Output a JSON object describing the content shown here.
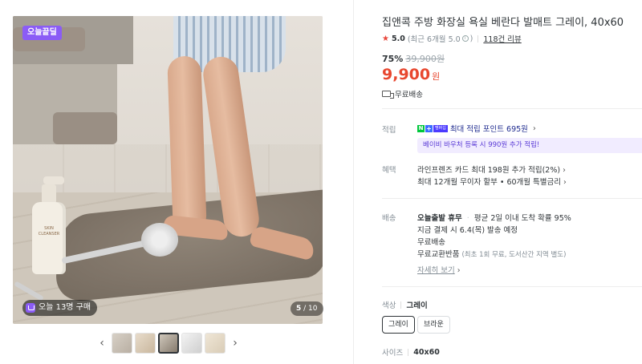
{
  "gallery": {
    "badge": "오늘끝딜",
    "purchase_text": "오늘 13명 구매",
    "counter_current": "5",
    "counter_total": "/ 10",
    "bottle_label": "SKIN CLEANSER",
    "prev_arrow": "‹",
    "next_arrow": "›"
  },
  "product": {
    "title": "집앤콕 주방 화장실 욕실 베란다 발매트 그레이, 40x60",
    "rating": "5.0",
    "rating_sub": "(최근 6개월 5.0",
    "rating_close": ")",
    "review_count": "118건 리뷰",
    "discount_rate": "75%",
    "original_price": "39,900원",
    "price": "9,900",
    "currency": "원",
    "shipping": "무료배송"
  },
  "points": {
    "label": "적립",
    "npay_n": "N",
    "npay_plus": "+",
    "npay_tag": "멤버십",
    "text": "최대 적립 포인트 695원",
    "voucher": "베이비 바우처 등록 시 990원 추가 적립!"
  },
  "benefit": {
    "label": "혜택",
    "line1": "라인프렌즈 카드 최대 198원 추가 적립(2%)",
    "line2": "최대 12개월 무이자 할부 • 60개월 특별금리"
  },
  "delivery": {
    "label": "배송",
    "line1_bold": "오늘출발 휴무",
    "line1": "평균 2일 이내 도착 확률 95%",
    "line2": "지금 결제 시 6.4(목) 발송 예정",
    "line3": "무료배송",
    "line4": "무료교환반품",
    "line4_sub": "(최초 1회 무료, 도서산간 지역 별도)",
    "details": "자세히 보기"
  },
  "options": {
    "color_label": "색상",
    "color_selected": "그레이",
    "colors": [
      "그레이",
      "브라운"
    ],
    "size_label": "사이즈",
    "size_selected": "40x60"
  },
  "chevron": "›"
}
